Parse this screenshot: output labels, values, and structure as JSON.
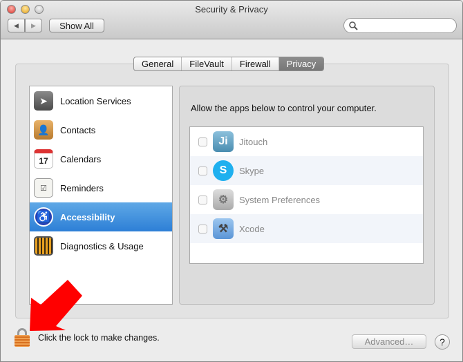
{
  "window": {
    "title": "Security & Privacy"
  },
  "toolbar": {
    "back_icon": "◀",
    "forward_icon": "▶",
    "show_all": "Show All",
    "search_placeholder": ""
  },
  "tabs": [
    {
      "label": "General"
    },
    {
      "label": "FileVault"
    },
    {
      "label": "Firewall"
    },
    {
      "label": "Privacy",
      "selected": true
    }
  ],
  "sidebar": {
    "items": [
      {
        "label": "Location Services",
        "icon": "location-arrow"
      },
      {
        "label": "Contacts",
        "icon": "contacts-book"
      },
      {
        "label": "Calendars",
        "icon": "calendar",
        "glyph": "17"
      },
      {
        "label": "Reminders",
        "icon": "checklist"
      },
      {
        "label": "Accessibility",
        "icon": "accessibility",
        "selected": true
      },
      {
        "label": "Diagnostics & Usage",
        "icon": "diagnostics-grid"
      }
    ]
  },
  "privacy": {
    "description": "Allow the apps below to control your computer.",
    "apps": [
      {
        "name": "Jitouch",
        "glyph": "Ji",
        "checked": false,
        "color": "#5b9fc2"
      },
      {
        "name": "Skype",
        "glyph": "S",
        "checked": false,
        "color": "#1fb0ef"
      },
      {
        "name": "System Preferences",
        "checked": false,
        "color": "#b5b5b5"
      },
      {
        "name": "Xcode",
        "checked": false,
        "color": "#6aa6e2"
      }
    ]
  },
  "footer": {
    "lock_text": "Click the lock to make changes.",
    "advanced": "Advanced…",
    "help": "?"
  },
  "colors": {
    "selection": "#2d7fd6",
    "arrow": "#ff0000",
    "lock": "#e8862a"
  }
}
